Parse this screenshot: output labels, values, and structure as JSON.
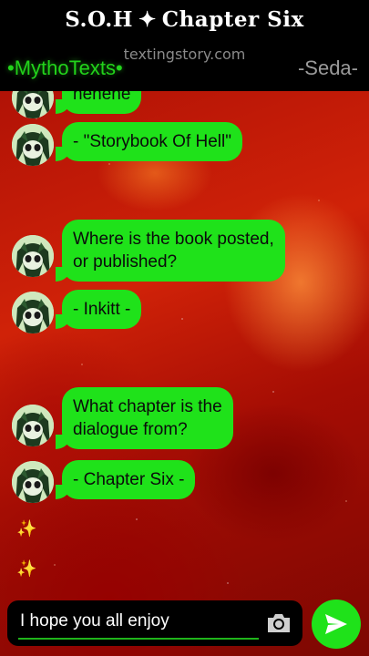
{
  "header": {
    "title_left": "S.O.H",
    "title_symbol": "✦",
    "title_right": "Chapter Six",
    "watermark": "textingstory.com",
    "brand": "•MythoTexts•",
    "contact": "-Seda-"
  },
  "messages": [
    {
      "text": "hehehe"
    },
    {
      "text": "- \"Storybook Of Hell\""
    },
    {
      "text_line1": "Where is the book posted,",
      "text_line2": "or published?"
    },
    {
      "text": "- Inkitt -"
    },
    {
      "text_line1": "What chapter is the",
      "text_line2": "dialogue from?"
    },
    {
      "text": "- Chapter Six -"
    }
  ],
  "sparkles": [
    "✨",
    "✨"
  ],
  "composer": {
    "input_value": "I hope you all enjoy",
    "camera_icon": "camera-icon",
    "send_icon": "send-icon"
  },
  "colors": {
    "bubble": "#1fe21a",
    "brand": "#22d31b",
    "background": "#b11206"
  }
}
